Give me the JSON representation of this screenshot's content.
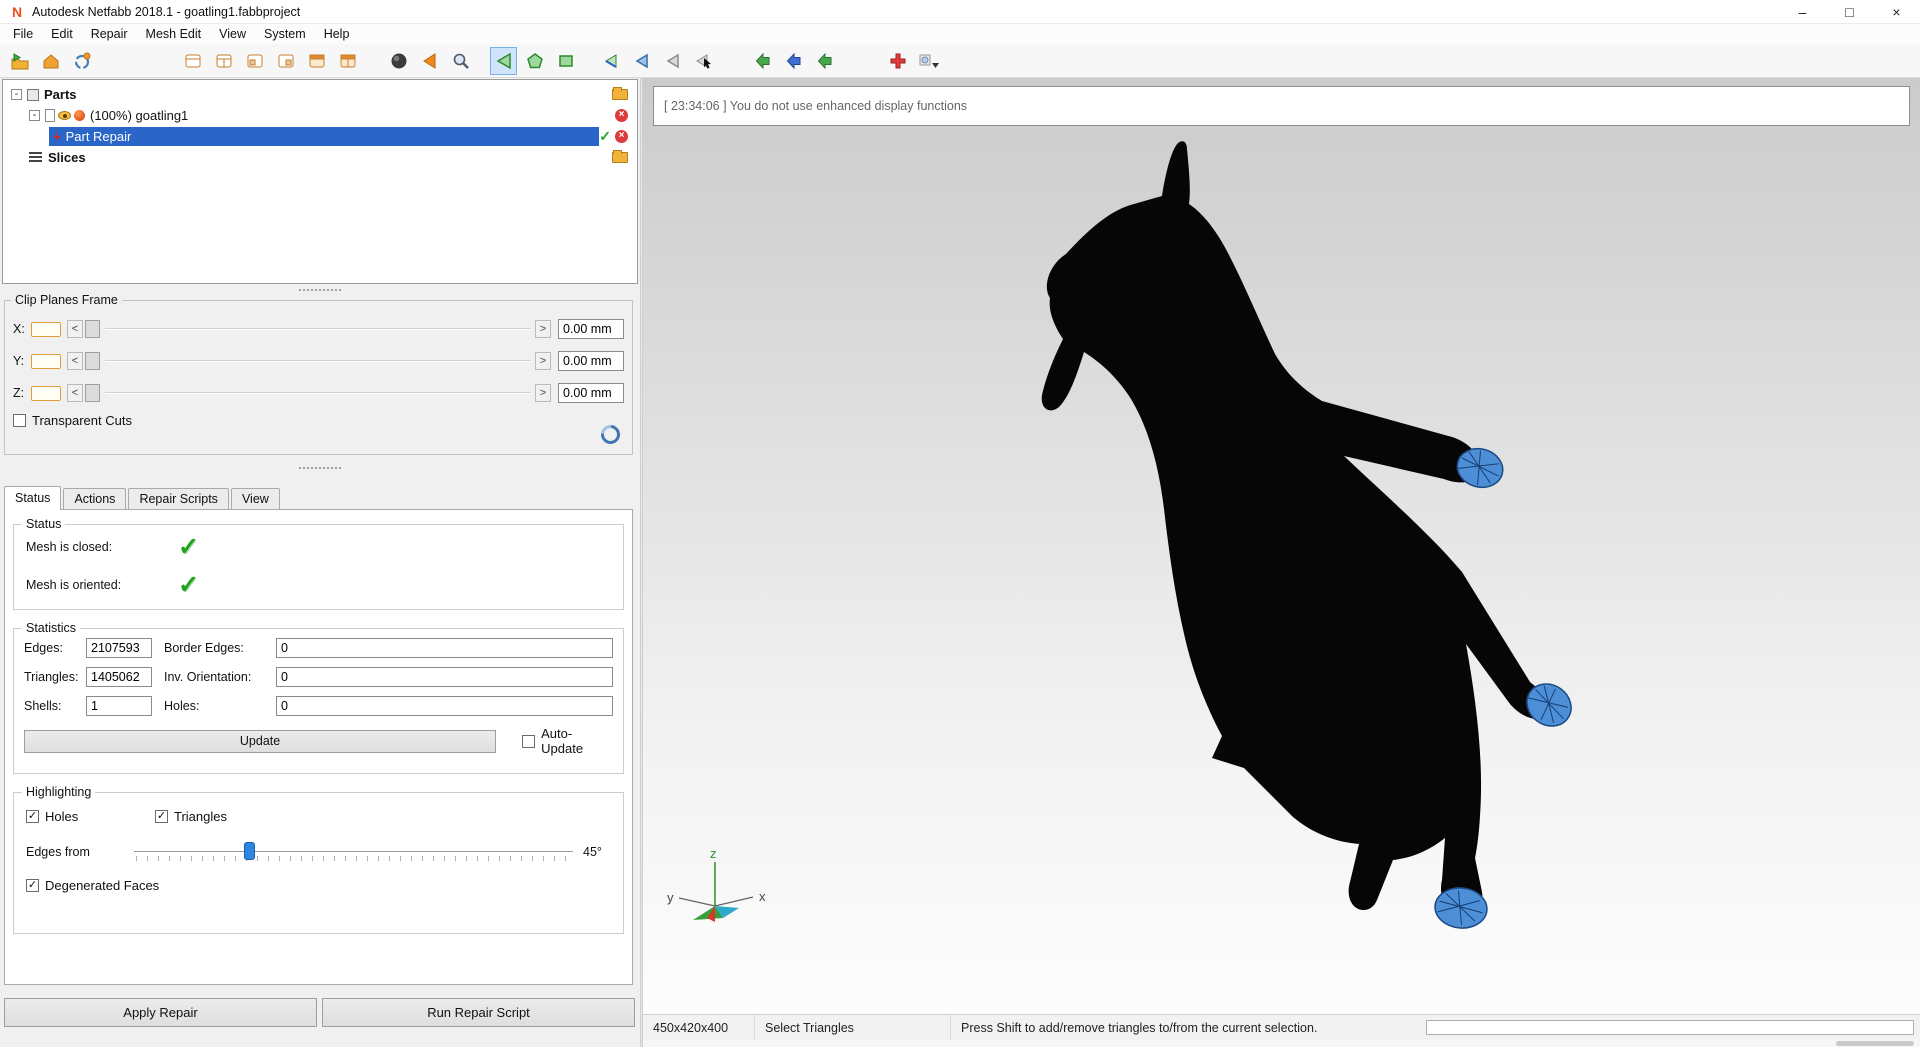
{
  "window": {
    "title": "Autodesk Netfabb 2018.1 - goatling1.fabbproject",
    "logo": "N",
    "minimize": "–",
    "maximize": "□",
    "close": "×"
  },
  "menu": {
    "items": [
      "File",
      "Edit",
      "Repair",
      "Mesh Edit",
      "View",
      "System",
      "Help"
    ]
  },
  "toolbar": {
    "icons": [
      "open-project",
      "import-part",
      "refresh-view",
      "platform-view-1",
      "platform-view-2",
      "platform-view-3",
      "platform-view-4",
      "platform-view-5",
      "platform-view-6",
      "shading-sphere",
      "orient-arrow",
      "zoom",
      "select-triangles",
      "select-polygon",
      "select-rectangle",
      "select-surface",
      "select-through",
      "select-none",
      "select-cursor",
      "nav-back-green",
      "nav-back-blue",
      "nav-forward-green",
      "add-repair",
      "brush-dropdown"
    ]
  },
  "tree": {
    "parts_label": "Parts",
    "part_label": "(100%) goatling1",
    "repair_label": "Part Repair",
    "slices_label": "Slices"
  },
  "clip": {
    "title": "Clip Planes Frame",
    "x_label": "X:",
    "y_label": "Y:",
    "z_label": "Z:",
    "x_value": "0.00 mm",
    "y_value": "0.00 mm",
    "z_value": "0.00 mm",
    "dec": "<",
    "inc": ">",
    "transparent_cuts": "Transparent Cuts"
  },
  "tabs": {
    "items": [
      "Status",
      "Actions",
      "Repair Scripts",
      "View"
    ],
    "active": "Status"
  },
  "status_group": {
    "title": "Status",
    "closed_label": "Mesh is closed:",
    "oriented_label": "Mesh is oriented:"
  },
  "stats": {
    "title": "Statistics",
    "edges_label": "Edges:",
    "edges_value": "2107593",
    "border_label": "Border Edges:",
    "border_value": "0",
    "triangles_label": "Triangles:",
    "triangles_value": "1405062",
    "inv_label": "Inv. Orientation:",
    "inv_value": "0",
    "shells_label": "Shells:",
    "shells_value": "1",
    "holes_label": "Holes:",
    "holes_value": "0",
    "update_label": "Update",
    "auto_update_label": "Auto-Update"
  },
  "highlight": {
    "title": "Highlighting",
    "holes_label": "Holes",
    "triangles_label": "Triangles",
    "edges_from_label": "Edges from",
    "angle_value": "45°",
    "degenerated_label": "Degenerated Faces"
  },
  "footer": {
    "apply_label": "Apply Repair",
    "run_label": "Run Repair Script"
  },
  "viewport": {
    "log_message": "[ 23:34:06 ] You do not use enhanced display functions",
    "axes": {
      "x": "x",
      "y": "y",
      "z": "z"
    }
  },
  "statusbar": {
    "dims": "450x420x400",
    "mode": "Select Triangles",
    "hint": "Press Shift to add/remove triangles to/from the current selection."
  },
  "glyphs": {
    "check": "✓",
    "cross": "×",
    "collapse": "-"
  },
  "colors": {
    "selection_blue": "#2a65c8",
    "hoof_blue": "#4c8fd6",
    "check_green": "#1fa31f",
    "accent_orange": "#e8941c"
  }
}
